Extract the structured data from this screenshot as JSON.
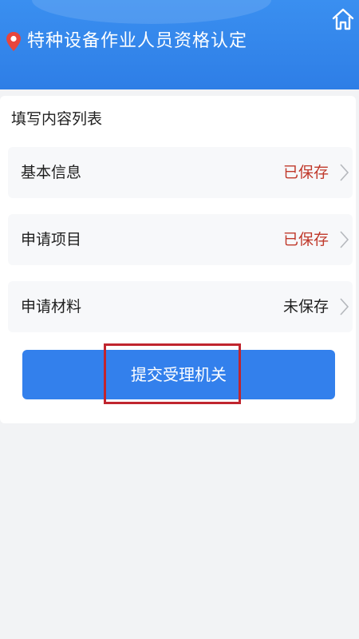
{
  "header": {
    "title": "特种设备作业人员资格认定",
    "location_icon": "location-pin-icon",
    "home_icon": "home-icon"
  },
  "content": {
    "section_title": "填写内容列表",
    "items": [
      {
        "label": "基本信息",
        "status": "已保存",
        "status_color": "#c0392b"
      },
      {
        "label": "申请项目",
        "status": "已保存",
        "status_color": "#c0392b"
      },
      {
        "label": "申请材料",
        "status": "未保存",
        "status_color": "#1f1f1f"
      }
    ],
    "submit_label": "提交受理机关"
  },
  "colors": {
    "header_blue": "#2e7ee6",
    "button_blue": "#3380ec",
    "highlight_red": "#c0252e"
  }
}
